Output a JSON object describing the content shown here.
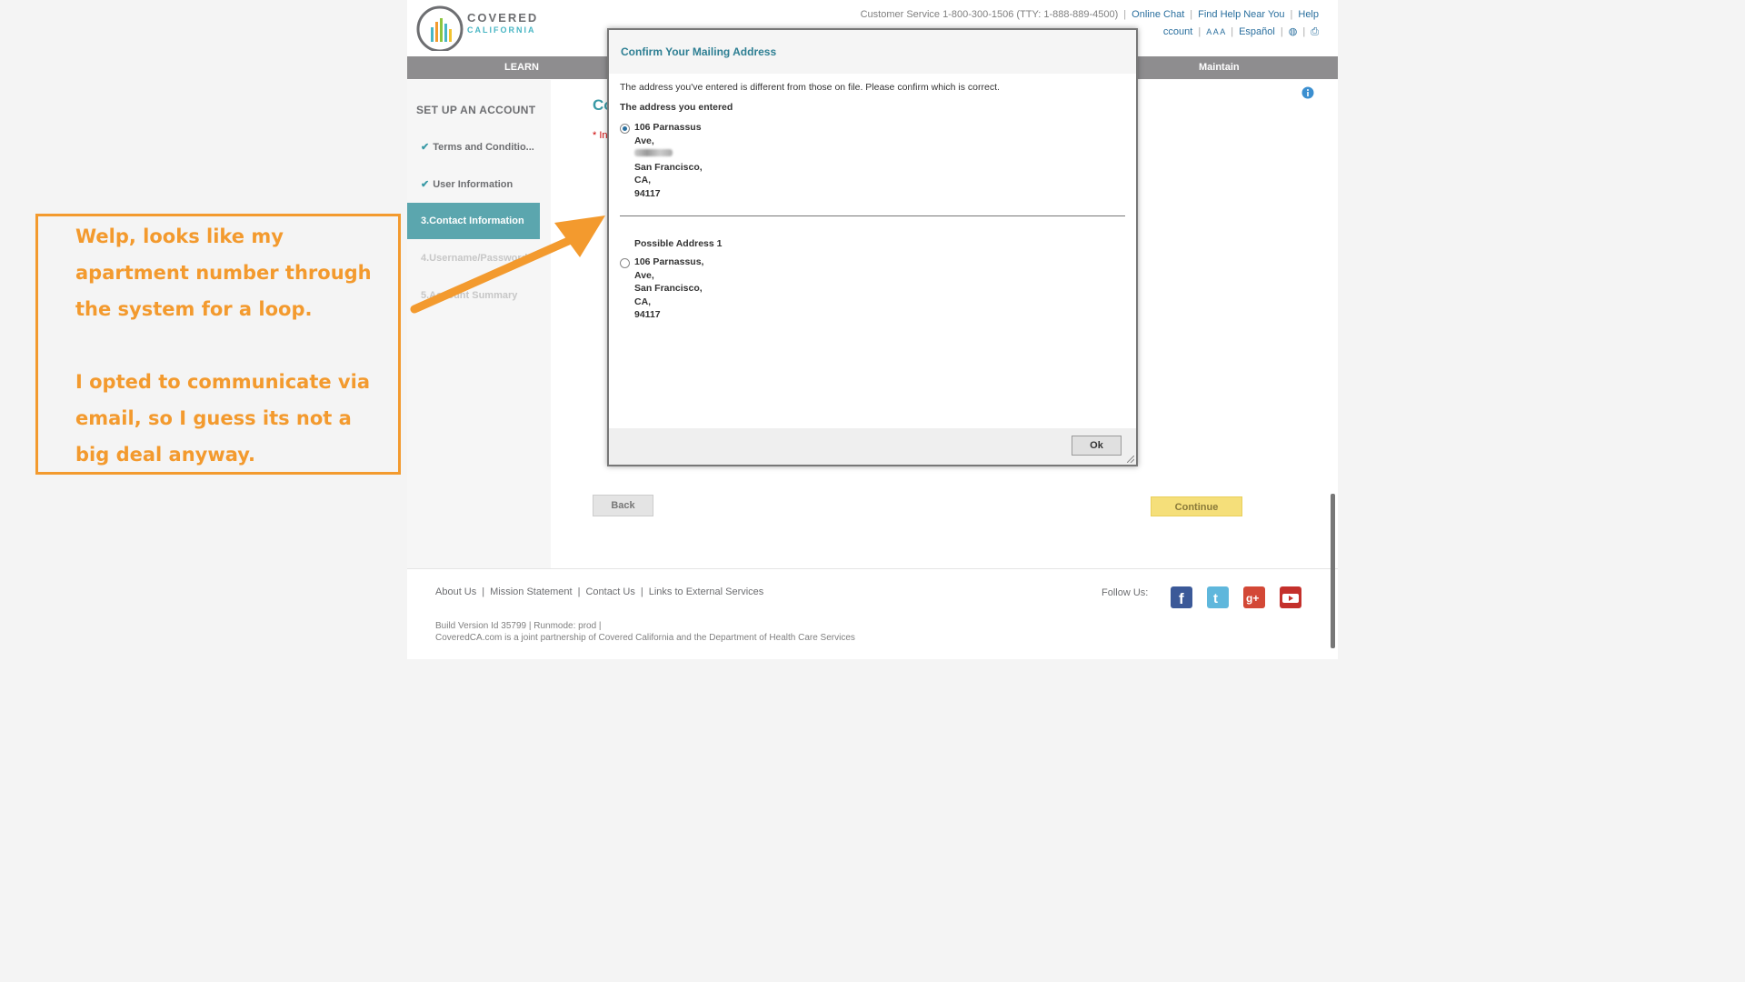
{
  "header": {
    "logo_line1": "COVERED",
    "logo_line2": "CALIFORNIA",
    "customer_service": "Customer Service 1-800-300-1506 (TTY: 1-888-889-4500)",
    "online_chat": "Online Chat",
    "find_help": "Find Help Near You",
    "help": "Help",
    "account_partial": "ccount",
    "text_size": "A A A",
    "espanol": "Español"
  },
  "nav": {
    "learn": "LEARN",
    "maintain": "Maintain"
  },
  "sidebar": {
    "title": "SET UP AN ACCOUNT",
    "steps": [
      {
        "label": "Terms and Conditio...",
        "state": "done"
      },
      {
        "label": "User Information",
        "state": "done"
      },
      {
        "label": "3.Contact Information",
        "state": "active"
      },
      {
        "label": "4.Username/Password",
        "state": "inactive"
      },
      {
        "label": "5.Account Summary",
        "state": "inactive"
      }
    ]
  },
  "main": {
    "heading_partial": "Co",
    "required_partial": "* In",
    "back_button": "Back",
    "continue_button": "Continue"
  },
  "modal": {
    "title": "Confirm Your Mailing Address",
    "message": "The address you've entered is different from those on file. Please confirm which is correct.",
    "entered_label": "The address you entered",
    "entered_address": {
      "line1": "106 Parnassus",
      "line2": "Ave,",
      "city": "San Francisco,",
      "state": "CA,",
      "zip": "94117"
    },
    "possible_label": "Possible Address 1",
    "possible_address": {
      "line1": "106 Parnassus,",
      "line2": "Ave,",
      "city": "San Francisco,",
      "state": "CA,",
      "zip": "94117"
    },
    "ok_button": "Ok"
  },
  "footer": {
    "links": [
      "About Us",
      "Mission Statement",
      "Contact Us",
      "Links to External Services"
    ],
    "follow_us": "Follow Us:",
    "build_line": "Build Version Id 35799  |   Runmode: prod  |",
    "partnership": "CoveredCA.com is a joint partnership of Covered California and the Department of Health Care Services"
  },
  "annotation": {
    "line1": "Welp, looks like my",
    "line2": "apartment number through",
    "line3": "the system for a loop.",
    "line4": "I opted to communicate via",
    "line5": "email, so I guess its not a",
    "line6": "big deal anyway."
  },
  "colors": {
    "brand_teal": "#3a9aa6",
    "annotation_orange": "#f39a2e",
    "nav_gray": "#8e8d8f",
    "continue_yellow": "#f5df7a"
  }
}
